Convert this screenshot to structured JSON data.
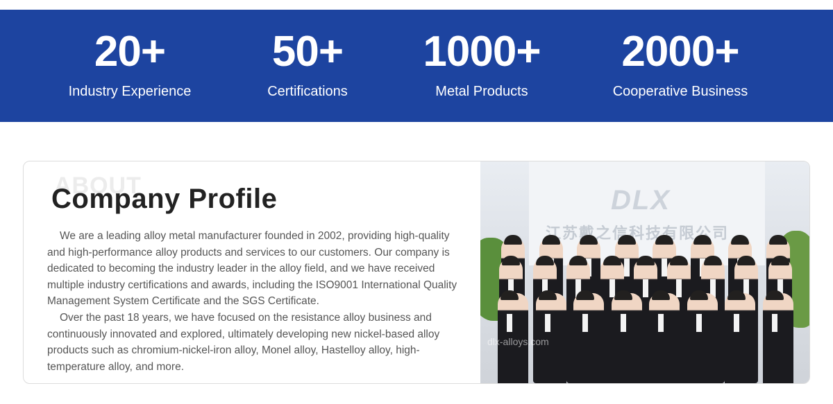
{
  "stats": [
    {
      "value": "20+",
      "label": "Industry Experience"
    },
    {
      "value": "50+",
      "label": "Certifications"
    },
    {
      "value": "1000+",
      "label": "Metal Products"
    },
    {
      "value": "2000+",
      "label": "Cooperative Business"
    }
  ],
  "profile": {
    "ghost": "ABOUT",
    "title": "Company Profile",
    "paragraphs": [
      "We are a leading alloy metal manufacturer founded in 2002, providing high-quality and high-performance alloy products and services to our customers. Our company is dedicated to becoming the industry leader in the alloy field, and we have received multiple industry certifications and awards, including the ISO9001 International Quality Management System Certificate and the SGS Certificate.",
      "Over the past 18 years, we have focused on the resistance alloy business and continuously innovated and explored, ultimately developing new nickel-based alloy products such as chromium-nickel-iron alloy, Monel alloy, Hastelloy alloy, high-temperature alloy, and more."
    ]
  },
  "photo": {
    "logo": "DLX",
    "sign": "江苏戴之信科技有限公司",
    "watermark": "dlx-alloys.com"
  }
}
